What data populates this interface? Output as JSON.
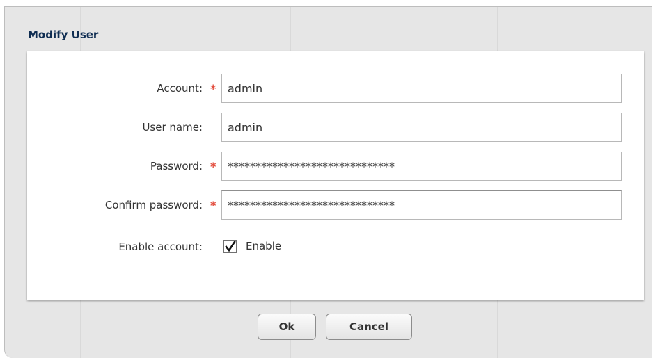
{
  "dialog": {
    "title": "Modify User"
  },
  "form": {
    "account": {
      "label": "Account:",
      "required": true,
      "value": "admin"
    },
    "user_name": {
      "label": "User name:",
      "required": false,
      "value": "admin"
    },
    "password": {
      "label": "Password:",
      "required": true,
      "value": "******************************"
    },
    "confirm_password": {
      "label": "Confirm password:",
      "required": true,
      "value": "******************************"
    },
    "enable_account": {
      "label": "Enable account:",
      "checked": true,
      "option_label": "Enable"
    },
    "required_marker": "*"
  },
  "buttons": {
    "ok_label": "Ok",
    "cancel_label": "Cancel"
  },
  "colors": {
    "title": "#0f2d52",
    "required_marker": "#e24a3a",
    "dialog_background": "#e6e6e6",
    "panel_background": "#ffffff"
  },
  "icons": {
    "checkbox_mark": "check-mark-icon"
  }
}
